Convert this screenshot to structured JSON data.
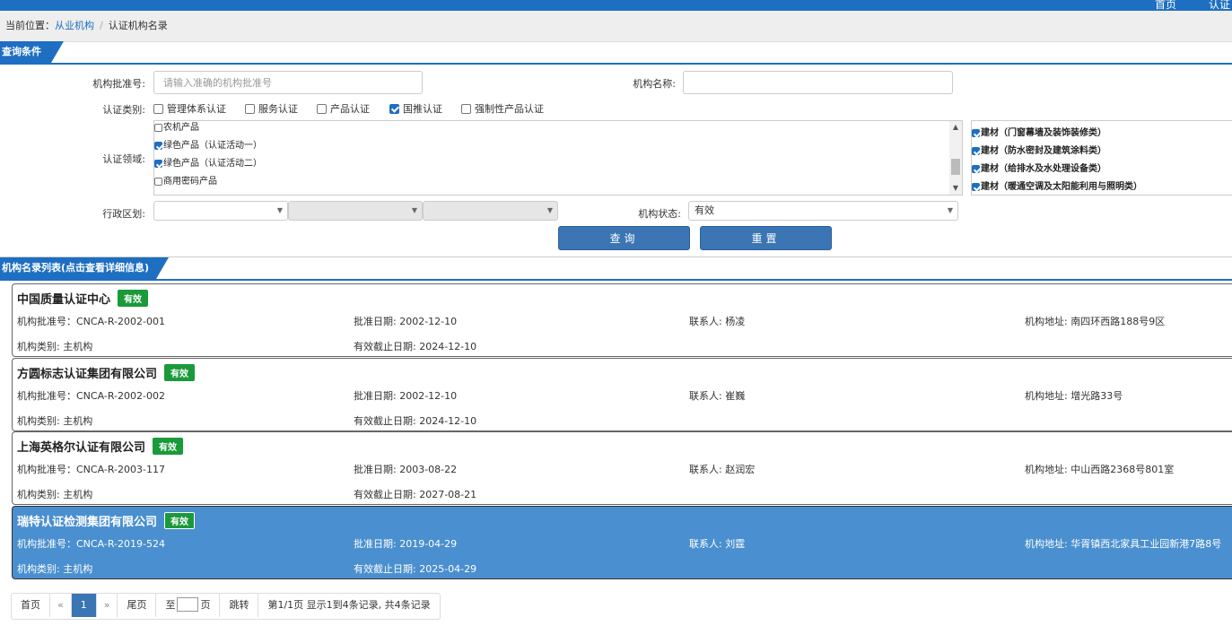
{
  "header": {
    "nav": [
      "首页",
      "认证"
    ]
  },
  "breadcrumb": {
    "prefix": "当前位置：",
    "link": "从业机构",
    "separator": "/",
    "current": "认证机构名录"
  },
  "query": {
    "title": "查询条件",
    "approval_no_label": "机构批准号:",
    "approval_no_placeholder": "请输入准确的机构批准号",
    "approval_no_value": "",
    "org_name_label": "机构名称:",
    "org_name_value": "",
    "cert_type_label": "认证类别:",
    "cert_types": [
      {
        "label": "管理体系认证",
        "checked": false
      },
      {
        "label": "服务认证",
        "checked": false
      },
      {
        "label": "产品认证",
        "checked": false
      },
      {
        "label": "国推认证",
        "checked": true
      },
      {
        "label": "强制性产品认证",
        "checked": false
      }
    ],
    "field_label": "认证领域:",
    "fields_left": [
      {
        "label": "农机产品",
        "checked": false
      },
      {
        "label": "绿色产品（认证活动一）",
        "checked": true
      },
      {
        "label": "绿色产品（认证活动二）",
        "checked": true
      },
      {
        "label": "商用密码产品",
        "checked": false
      }
    ],
    "fields_right": [
      {
        "label": "建材（门窗幕墙及装饰装修类）",
        "checked": true
      },
      {
        "label": "建材（防水密封及建筑涂料类）",
        "checked": true
      },
      {
        "label": "建材（给排水及水处理设备类）",
        "checked": true
      },
      {
        "label": "建材（暖通空调及太阳能利用与照明类）",
        "checked": true
      }
    ],
    "region_label": "行政区划:",
    "region_values": [
      "",
      "",
      ""
    ],
    "status_label": "机构状态:",
    "status_value": "有效",
    "search_button": "查询",
    "reset_button": "重置"
  },
  "list": {
    "title": "机构名录列表(点击查看详细信息)",
    "items": [
      {
        "name": "中国质量认证中心",
        "status": "有效",
        "approval_no": "机构批准号：CNCA-R-2002-001",
        "approval_date": "批准日期: 2002-12-10",
        "contact": "联系人: 杨凌",
        "address": "机构地址: 南四环西路188号9区",
        "category": "机构类别: 主机构",
        "expiry": "有效截止日期: 2024-12-10"
      },
      {
        "name": "方圆标志认证集团有限公司",
        "status": "有效",
        "approval_no": "机构批准号：CNCA-R-2002-002",
        "approval_date": "批准日期: 2002-12-10",
        "contact": "联系人: 崔巍",
        "address": "机构地址: 增光路33号",
        "category": "机构类别: 主机构",
        "expiry": "有效截止日期: 2024-12-10"
      },
      {
        "name": "上海英格尔认证有限公司",
        "status": "有效",
        "approval_no": "机构批准号：CNCA-R-2003-117",
        "approval_date": "批准日期: 2003-08-22",
        "contact": "联系人: 赵润宏",
        "address": "机构地址: 中山西路2368号801室",
        "category": "机构类别: 主机构",
        "expiry": "有效截止日期: 2027-08-21"
      },
      {
        "name": "瑞特认证检测集团有限公司",
        "status": "有效",
        "approval_no": "机构批准号：CNCA-R-2019-524",
        "approval_date": "批准日期: 2019-04-29",
        "contact": "联系人: 刘霆",
        "address": "机构地址: 华胥镇西北家具工业园新港7路8号",
        "category": "机构类别: 主机构",
        "expiry": "有效截止日期: 2025-04-29"
      }
    ]
  },
  "pager": {
    "first": "首页",
    "prev": "«",
    "current_page": "1",
    "next": "»",
    "last": "尾页",
    "goto_prefix": "至",
    "goto_value": "",
    "goto_suffix": "页",
    "jump": "跳转",
    "summary": "第1/1页  显示1到4条记录, 共4条记录"
  }
}
